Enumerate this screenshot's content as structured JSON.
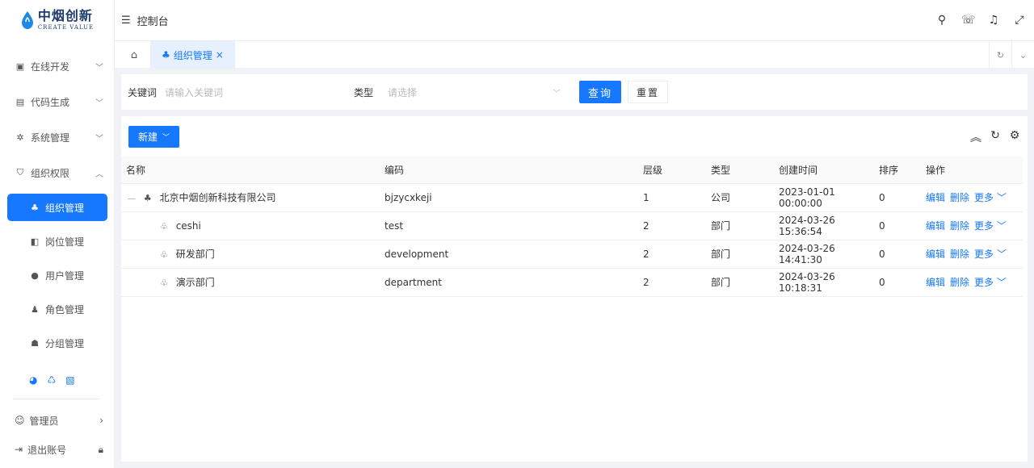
{
  "brand": {
    "name_cn": "中烟创新",
    "name_en": "CREATE VALUE"
  },
  "header": {
    "title": "控制台"
  },
  "sidebar": {
    "items": [
      {
        "label": "在线开发",
        "icon": "terminal-icon"
      },
      {
        "label": "代码生成",
        "icon": "code-icon"
      },
      {
        "label": "系统管理",
        "icon": "gear-icon"
      },
      {
        "label": "组织权限",
        "icon": "shield-icon"
      }
    ],
    "sub_items": [
      {
        "label": "组织管理",
        "icon": "org-icon",
        "active": true
      },
      {
        "label": "岗位管理",
        "icon": "post-icon"
      },
      {
        "label": "用户管理",
        "icon": "user-icon"
      },
      {
        "label": "角色管理",
        "icon": "role-icon"
      },
      {
        "label": "分组管理",
        "icon": "group-icon"
      }
    ],
    "admin_label": "管理员",
    "logout_label": "退出账号"
  },
  "tabs": {
    "active_label": "组织管理"
  },
  "search": {
    "keyword_label": "关键词",
    "keyword_placeholder": "请输入关键词",
    "type_label": "类型",
    "type_placeholder": "请选择",
    "query_label": "查询",
    "reset_label": "重置"
  },
  "table": {
    "new_label": "新建",
    "columns": [
      "名称",
      "编码",
      "层级",
      "类型",
      "创建时间",
      "排序",
      "操作"
    ],
    "rows": [
      {
        "name": "北京中烟创新科技有限公司",
        "code": "bjzycxkeji",
        "level": "1",
        "type": "公司",
        "created": "2023-01-01 00:00:00",
        "sort": "0"
      },
      {
        "name": "ceshi",
        "code": "test",
        "level": "2",
        "type": "部门",
        "created": "2024-03-26 15:36:54",
        "sort": "0"
      },
      {
        "name": "研发部门",
        "code": "development",
        "level": "2",
        "type": "部门",
        "created": "2024-03-26 14:41:30",
        "sort": "0"
      },
      {
        "name": "演示部门",
        "code": "department",
        "level": "2",
        "type": "部门",
        "created": "2024-03-26 10:18:31",
        "sort": "0"
      }
    ],
    "ops": {
      "edit": "编辑",
      "delete": "删除",
      "more": "更多"
    }
  },
  "colors": {
    "primary": "#1677ff"
  }
}
